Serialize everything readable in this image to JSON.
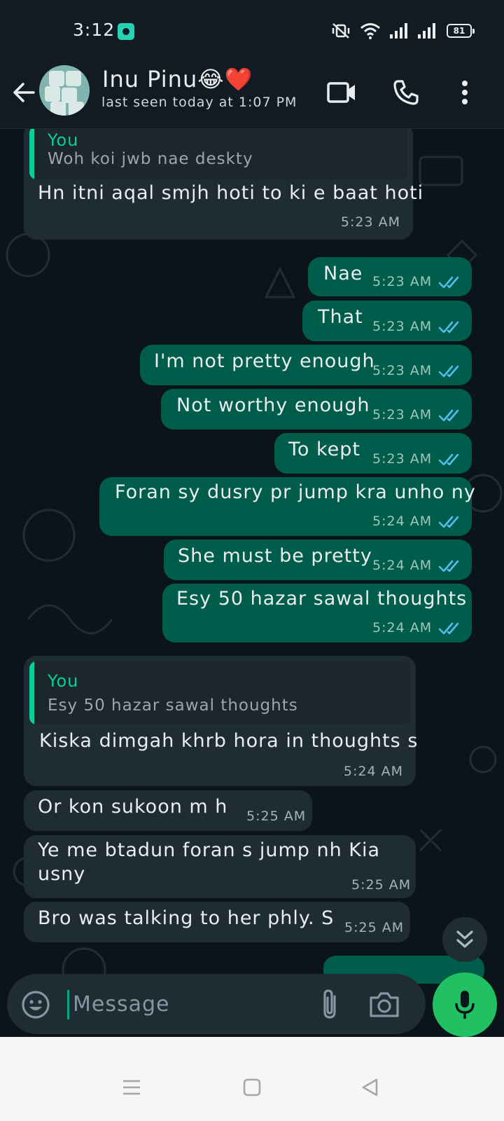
{
  "status_bar": {
    "time": "3:12",
    "battery": "81",
    "icons": [
      "silent-vibrate-icon",
      "wifi-icon",
      "signal-icon",
      "signal-icon"
    ]
  },
  "header": {
    "contact_name": "Inu Pinu😂❤️",
    "last_seen": "last seen today at 1:07 PM",
    "actions": [
      "video-call-icon",
      "voice-call-icon",
      "more-options-icon"
    ]
  },
  "messages": [
    {
      "direction": "in",
      "quote": {
        "author": "You",
        "text": "Woh koi jwb nae deskty"
      },
      "text": "Hn itni aqal smjh hoti to ki e baat hoti",
      "time": "5:23 AM"
    },
    {
      "direction": "out",
      "text": "Nae",
      "time": "5:23 AM",
      "status": "read"
    },
    {
      "direction": "out",
      "text": "That",
      "time": "5:23 AM",
      "status": "read"
    },
    {
      "direction": "out",
      "text": "I'm not pretty enough",
      "time": "5:23 AM",
      "status": "read"
    },
    {
      "direction": "out",
      "text": "Not worthy enough",
      "time": "5:23 AM",
      "status": "read"
    },
    {
      "direction": "out",
      "text": "To kept",
      "time": "5:23 AM",
      "status": "read"
    },
    {
      "direction": "out",
      "text": "Foran sy dusry pr jump kra unho ny",
      "time": "5:24 AM",
      "status": "read"
    },
    {
      "direction": "out",
      "text": "She must be pretty",
      "time": "5:24 AM",
      "status": "read"
    },
    {
      "direction": "out",
      "text": "Esy 50 hazar sawal thoughts",
      "time": "5:24 AM",
      "status": "read"
    },
    {
      "direction": "in",
      "quote": {
        "author": "You",
        "text": "Esy 50 hazar sawal thoughts"
      },
      "text": "Kiska dimgah khrb hora in thoughts s",
      "time": "5:24 AM"
    },
    {
      "direction": "in",
      "text": "Or kon sukoon m h",
      "time": "5:25 AM"
    },
    {
      "direction": "in",
      "text": "Ye me btadun foran s jump nh Kia usny",
      "text_line1": "Ye me btadun foran s jump nh Kia",
      "text_line2": "usny",
      "time": "5:25 AM"
    },
    {
      "direction": "in",
      "text": "Bro was talking to her phly. S",
      "time": "5:25 AM"
    }
  ],
  "composer": {
    "placeholder": "Message"
  },
  "colors": {
    "background": "#0b141a",
    "incoming_bubble": "#202c33",
    "outgoing_bubble": "#005c4b",
    "accent": "#00a884",
    "read_ticks": "#53bdeb",
    "mic_button": "#21c063"
  },
  "nav_bar": {
    "buttons": [
      "menu-icon",
      "home-icon",
      "back-triangle-icon"
    ]
  }
}
